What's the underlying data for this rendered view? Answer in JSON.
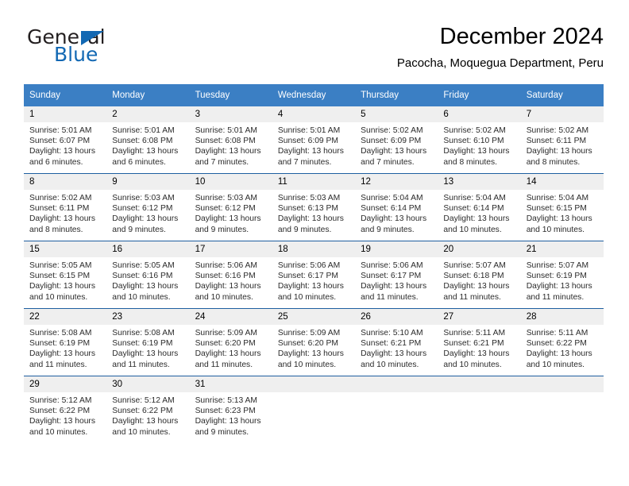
{
  "logo": {
    "word_one": "General",
    "word_two": "Blue",
    "triangle_color": "#1268b3",
    "text_color": "#231f20"
  },
  "header": {
    "month_title": "December 2024",
    "location": "Pacocha, Moquegua Department, Peru"
  },
  "theme": {
    "header_bg": "#3b7fc4",
    "header_text": "#ffffff",
    "row_divider": "#1f5fa0",
    "daynum_bg": "#efefef",
    "cell_bg": "#ffffff"
  },
  "weekdays": [
    "Sunday",
    "Monday",
    "Tuesday",
    "Wednesday",
    "Thursday",
    "Friday",
    "Saturday"
  ],
  "weeks": [
    [
      {
        "day": "1",
        "sunrise": "Sunrise: 5:01 AM",
        "sunset": "Sunset: 6:07 PM",
        "daylight_1": "Daylight: 13 hours",
        "daylight_2": "and 6 minutes."
      },
      {
        "day": "2",
        "sunrise": "Sunrise: 5:01 AM",
        "sunset": "Sunset: 6:08 PM",
        "daylight_1": "Daylight: 13 hours",
        "daylight_2": "and 6 minutes."
      },
      {
        "day": "3",
        "sunrise": "Sunrise: 5:01 AM",
        "sunset": "Sunset: 6:08 PM",
        "daylight_1": "Daylight: 13 hours",
        "daylight_2": "and 7 minutes."
      },
      {
        "day": "4",
        "sunrise": "Sunrise: 5:01 AM",
        "sunset": "Sunset: 6:09 PM",
        "daylight_1": "Daylight: 13 hours",
        "daylight_2": "and 7 minutes."
      },
      {
        "day": "5",
        "sunrise": "Sunrise: 5:02 AM",
        "sunset": "Sunset: 6:09 PM",
        "daylight_1": "Daylight: 13 hours",
        "daylight_2": "and 7 minutes."
      },
      {
        "day": "6",
        "sunrise": "Sunrise: 5:02 AM",
        "sunset": "Sunset: 6:10 PM",
        "daylight_1": "Daylight: 13 hours",
        "daylight_2": "and 8 minutes."
      },
      {
        "day": "7",
        "sunrise": "Sunrise: 5:02 AM",
        "sunset": "Sunset: 6:11 PM",
        "daylight_1": "Daylight: 13 hours",
        "daylight_2": "and 8 minutes."
      }
    ],
    [
      {
        "day": "8",
        "sunrise": "Sunrise: 5:02 AM",
        "sunset": "Sunset: 6:11 PM",
        "daylight_1": "Daylight: 13 hours",
        "daylight_2": "and 8 minutes."
      },
      {
        "day": "9",
        "sunrise": "Sunrise: 5:03 AM",
        "sunset": "Sunset: 6:12 PM",
        "daylight_1": "Daylight: 13 hours",
        "daylight_2": "and 9 minutes."
      },
      {
        "day": "10",
        "sunrise": "Sunrise: 5:03 AM",
        "sunset": "Sunset: 6:12 PM",
        "daylight_1": "Daylight: 13 hours",
        "daylight_2": "and 9 minutes."
      },
      {
        "day": "11",
        "sunrise": "Sunrise: 5:03 AM",
        "sunset": "Sunset: 6:13 PM",
        "daylight_1": "Daylight: 13 hours",
        "daylight_2": "and 9 minutes."
      },
      {
        "day": "12",
        "sunrise": "Sunrise: 5:04 AM",
        "sunset": "Sunset: 6:14 PM",
        "daylight_1": "Daylight: 13 hours",
        "daylight_2": "and 9 minutes."
      },
      {
        "day": "13",
        "sunrise": "Sunrise: 5:04 AM",
        "sunset": "Sunset: 6:14 PM",
        "daylight_1": "Daylight: 13 hours",
        "daylight_2": "and 10 minutes."
      },
      {
        "day": "14",
        "sunrise": "Sunrise: 5:04 AM",
        "sunset": "Sunset: 6:15 PM",
        "daylight_1": "Daylight: 13 hours",
        "daylight_2": "and 10 minutes."
      }
    ],
    [
      {
        "day": "15",
        "sunrise": "Sunrise: 5:05 AM",
        "sunset": "Sunset: 6:15 PM",
        "daylight_1": "Daylight: 13 hours",
        "daylight_2": "and 10 minutes."
      },
      {
        "day": "16",
        "sunrise": "Sunrise: 5:05 AM",
        "sunset": "Sunset: 6:16 PM",
        "daylight_1": "Daylight: 13 hours",
        "daylight_2": "and 10 minutes."
      },
      {
        "day": "17",
        "sunrise": "Sunrise: 5:06 AM",
        "sunset": "Sunset: 6:16 PM",
        "daylight_1": "Daylight: 13 hours",
        "daylight_2": "and 10 minutes."
      },
      {
        "day": "18",
        "sunrise": "Sunrise: 5:06 AM",
        "sunset": "Sunset: 6:17 PM",
        "daylight_1": "Daylight: 13 hours",
        "daylight_2": "and 10 minutes."
      },
      {
        "day": "19",
        "sunrise": "Sunrise: 5:06 AM",
        "sunset": "Sunset: 6:17 PM",
        "daylight_1": "Daylight: 13 hours",
        "daylight_2": "and 11 minutes."
      },
      {
        "day": "20",
        "sunrise": "Sunrise: 5:07 AM",
        "sunset": "Sunset: 6:18 PM",
        "daylight_1": "Daylight: 13 hours",
        "daylight_2": "and 11 minutes."
      },
      {
        "day": "21",
        "sunrise": "Sunrise: 5:07 AM",
        "sunset": "Sunset: 6:19 PM",
        "daylight_1": "Daylight: 13 hours",
        "daylight_2": "and 11 minutes."
      }
    ],
    [
      {
        "day": "22",
        "sunrise": "Sunrise: 5:08 AM",
        "sunset": "Sunset: 6:19 PM",
        "daylight_1": "Daylight: 13 hours",
        "daylight_2": "and 11 minutes."
      },
      {
        "day": "23",
        "sunrise": "Sunrise: 5:08 AM",
        "sunset": "Sunset: 6:19 PM",
        "daylight_1": "Daylight: 13 hours",
        "daylight_2": "and 11 minutes."
      },
      {
        "day": "24",
        "sunrise": "Sunrise: 5:09 AM",
        "sunset": "Sunset: 6:20 PM",
        "daylight_1": "Daylight: 13 hours",
        "daylight_2": "and 11 minutes."
      },
      {
        "day": "25",
        "sunrise": "Sunrise: 5:09 AM",
        "sunset": "Sunset: 6:20 PM",
        "daylight_1": "Daylight: 13 hours",
        "daylight_2": "and 10 minutes."
      },
      {
        "day": "26",
        "sunrise": "Sunrise: 5:10 AM",
        "sunset": "Sunset: 6:21 PM",
        "daylight_1": "Daylight: 13 hours",
        "daylight_2": "and 10 minutes."
      },
      {
        "day": "27",
        "sunrise": "Sunrise: 5:11 AM",
        "sunset": "Sunset: 6:21 PM",
        "daylight_1": "Daylight: 13 hours",
        "daylight_2": "and 10 minutes."
      },
      {
        "day": "28",
        "sunrise": "Sunrise: 5:11 AM",
        "sunset": "Sunset: 6:22 PM",
        "daylight_1": "Daylight: 13 hours",
        "daylight_2": "and 10 minutes."
      }
    ],
    [
      {
        "day": "29",
        "sunrise": "Sunrise: 5:12 AM",
        "sunset": "Sunset: 6:22 PM",
        "daylight_1": "Daylight: 13 hours",
        "daylight_2": "and 10 minutes."
      },
      {
        "day": "30",
        "sunrise": "Sunrise: 5:12 AM",
        "sunset": "Sunset: 6:22 PM",
        "daylight_1": "Daylight: 13 hours",
        "daylight_2": "and 10 minutes."
      },
      {
        "day": "31",
        "sunrise": "Sunrise: 5:13 AM",
        "sunset": "Sunset: 6:23 PM",
        "daylight_1": "Daylight: 13 hours",
        "daylight_2": "and 9 minutes."
      },
      {
        "day": "",
        "sunrise": "",
        "sunset": "",
        "daylight_1": "",
        "daylight_2": ""
      },
      {
        "day": "",
        "sunrise": "",
        "sunset": "",
        "daylight_1": "",
        "daylight_2": ""
      },
      {
        "day": "",
        "sunrise": "",
        "sunset": "",
        "daylight_1": "",
        "daylight_2": ""
      },
      {
        "day": "",
        "sunrise": "",
        "sunset": "",
        "daylight_1": "",
        "daylight_2": ""
      }
    ]
  ]
}
